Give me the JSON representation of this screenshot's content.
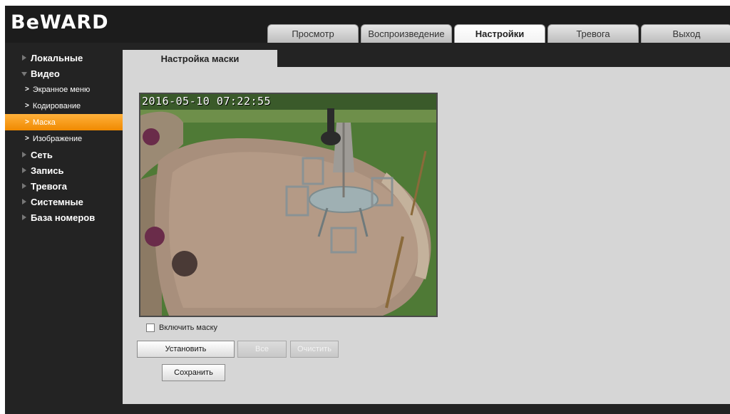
{
  "app": {
    "logo": "BeWARD"
  },
  "nav_tabs": [
    {
      "label": "Просмотр",
      "active": false
    },
    {
      "label": "Воспроизведение",
      "active": false
    },
    {
      "label": "Настройки",
      "active": true
    },
    {
      "label": "Тревога",
      "active": false
    },
    {
      "label": "Выход",
      "active": false
    }
  ],
  "sidebar": {
    "items": [
      {
        "label": "Локальные"
      },
      {
        "label": "Видео",
        "expanded": true,
        "children": [
          {
            "label": "Экранное меню"
          },
          {
            "label": "Кодирование"
          },
          {
            "label": "Маска",
            "active": true
          },
          {
            "label": "Изображение"
          }
        ]
      },
      {
        "label": "Сеть"
      },
      {
        "label": "Запись"
      },
      {
        "label": "Тревога"
      },
      {
        "label": "Системные"
      },
      {
        "label": "База номеров"
      }
    ]
  },
  "main": {
    "tab_label": "Настройка маски",
    "video": {
      "timestamp": "2016-05-10 07:22:55"
    },
    "enable_mask_label": "Включить маску",
    "enable_mask_checked": false,
    "buttons": {
      "set": "Установить",
      "all": "Все",
      "clear": "Очистить",
      "save": "Сохранить"
    }
  },
  "colors": {
    "accent": "#f59a12",
    "background": "#232323",
    "panel": "#d6d6d6"
  }
}
